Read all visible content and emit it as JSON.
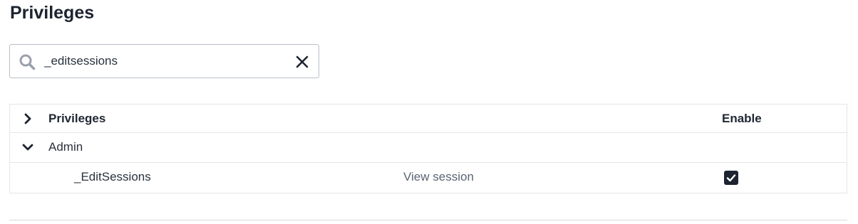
{
  "page": {
    "title": "Privileges"
  },
  "search": {
    "value": "_editsessions",
    "search_icon": "search-icon",
    "clear_icon": "close-icon"
  },
  "table": {
    "header": {
      "name_label": "Privileges",
      "enable_label": "Enable",
      "chevron_icon": "chevron-right-icon"
    },
    "groups": [
      {
        "label": "Admin",
        "expanded": true,
        "chevron_icon": "chevron-down-icon",
        "items": [
          {
            "name": "_EditSessions",
            "description": "View session",
            "enabled": true
          }
        ]
      }
    ]
  },
  "colors": {
    "text_dark": "#1c2430",
    "border": "#e3e6ea",
    "checkbox_fill": "#1c2430"
  }
}
